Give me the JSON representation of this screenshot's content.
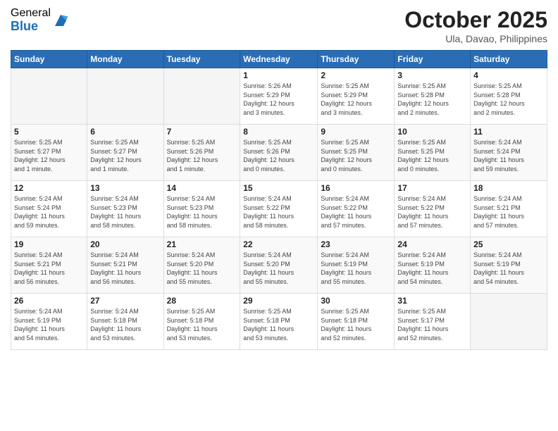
{
  "logo": {
    "general": "General",
    "blue": "Blue"
  },
  "title": "October 2025",
  "location": "Ula, Davao, Philippines",
  "weekdays": [
    "Sunday",
    "Monday",
    "Tuesday",
    "Wednesday",
    "Thursday",
    "Friday",
    "Saturday"
  ],
  "weeks": [
    [
      {
        "day": "",
        "info": ""
      },
      {
        "day": "",
        "info": ""
      },
      {
        "day": "",
        "info": ""
      },
      {
        "day": "1",
        "info": "Sunrise: 5:26 AM\nSunset: 5:29 PM\nDaylight: 12 hours\nand 3 minutes."
      },
      {
        "day": "2",
        "info": "Sunrise: 5:25 AM\nSunset: 5:29 PM\nDaylight: 12 hours\nand 3 minutes."
      },
      {
        "day": "3",
        "info": "Sunrise: 5:25 AM\nSunset: 5:28 PM\nDaylight: 12 hours\nand 2 minutes."
      },
      {
        "day": "4",
        "info": "Sunrise: 5:25 AM\nSunset: 5:28 PM\nDaylight: 12 hours\nand 2 minutes."
      }
    ],
    [
      {
        "day": "5",
        "info": "Sunrise: 5:25 AM\nSunset: 5:27 PM\nDaylight: 12 hours\nand 1 minute."
      },
      {
        "day": "6",
        "info": "Sunrise: 5:25 AM\nSunset: 5:27 PM\nDaylight: 12 hours\nand 1 minute."
      },
      {
        "day": "7",
        "info": "Sunrise: 5:25 AM\nSunset: 5:26 PM\nDaylight: 12 hours\nand 1 minute."
      },
      {
        "day": "8",
        "info": "Sunrise: 5:25 AM\nSunset: 5:26 PM\nDaylight: 12 hours\nand 0 minutes."
      },
      {
        "day": "9",
        "info": "Sunrise: 5:25 AM\nSunset: 5:25 PM\nDaylight: 12 hours\nand 0 minutes."
      },
      {
        "day": "10",
        "info": "Sunrise: 5:25 AM\nSunset: 5:25 PM\nDaylight: 12 hours\nand 0 minutes."
      },
      {
        "day": "11",
        "info": "Sunrise: 5:24 AM\nSunset: 5:24 PM\nDaylight: 11 hours\nand 59 minutes."
      }
    ],
    [
      {
        "day": "12",
        "info": "Sunrise: 5:24 AM\nSunset: 5:24 PM\nDaylight: 11 hours\nand 59 minutes."
      },
      {
        "day": "13",
        "info": "Sunrise: 5:24 AM\nSunset: 5:23 PM\nDaylight: 11 hours\nand 58 minutes."
      },
      {
        "day": "14",
        "info": "Sunrise: 5:24 AM\nSunset: 5:23 PM\nDaylight: 11 hours\nand 58 minutes."
      },
      {
        "day": "15",
        "info": "Sunrise: 5:24 AM\nSunset: 5:22 PM\nDaylight: 11 hours\nand 58 minutes."
      },
      {
        "day": "16",
        "info": "Sunrise: 5:24 AM\nSunset: 5:22 PM\nDaylight: 11 hours\nand 57 minutes."
      },
      {
        "day": "17",
        "info": "Sunrise: 5:24 AM\nSunset: 5:22 PM\nDaylight: 11 hours\nand 57 minutes."
      },
      {
        "day": "18",
        "info": "Sunrise: 5:24 AM\nSunset: 5:21 PM\nDaylight: 11 hours\nand 57 minutes."
      }
    ],
    [
      {
        "day": "19",
        "info": "Sunrise: 5:24 AM\nSunset: 5:21 PM\nDaylight: 11 hours\nand 56 minutes."
      },
      {
        "day": "20",
        "info": "Sunrise: 5:24 AM\nSunset: 5:21 PM\nDaylight: 11 hours\nand 56 minutes."
      },
      {
        "day": "21",
        "info": "Sunrise: 5:24 AM\nSunset: 5:20 PM\nDaylight: 11 hours\nand 55 minutes."
      },
      {
        "day": "22",
        "info": "Sunrise: 5:24 AM\nSunset: 5:20 PM\nDaylight: 11 hours\nand 55 minutes."
      },
      {
        "day": "23",
        "info": "Sunrise: 5:24 AM\nSunset: 5:19 PM\nDaylight: 11 hours\nand 55 minutes."
      },
      {
        "day": "24",
        "info": "Sunrise: 5:24 AM\nSunset: 5:19 PM\nDaylight: 11 hours\nand 54 minutes."
      },
      {
        "day": "25",
        "info": "Sunrise: 5:24 AM\nSunset: 5:19 PM\nDaylight: 11 hours\nand 54 minutes."
      }
    ],
    [
      {
        "day": "26",
        "info": "Sunrise: 5:24 AM\nSunset: 5:19 PM\nDaylight: 11 hours\nand 54 minutes."
      },
      {
        "day": "27",
        "info": "Sunrise: 5:24 AM\nSunset: 5:18 PM\nDaylight: 11 hours\nand 53 minutes."
      },
      {
        "day": "28",
        "info": "Sunrise: 5:25 AM\nSunset: 5:18 PM\nDaylight: 11 hours\nand 53 minutes."
      },
      {
        "day": "29",
        "info": "Sunrise: 5:25 AM\nSunset: 5:18 PM\nDaylight: 11 hours\nand 53 minutes."
      },
      {
        "day": "30",
        "info": "Sunrise: 5:25 AM\nSunset: 5:18 PM\nDaylight: 11 hours\nand 52 minutes."
      },
      {
        "day": "31",
        "info": "Sunrise: 5:25 AM\nSunset: 5:17 PM\nDaylight: 11 hours\nand 52 minutes."
      },
      {
        "day": "",
        "info": ""
      }
    ]
  ]
}
